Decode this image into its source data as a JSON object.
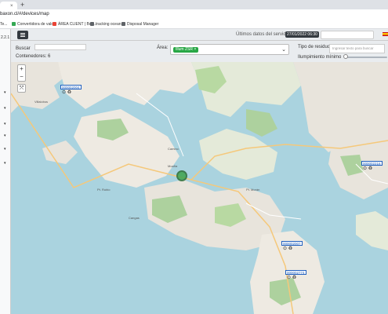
{
  "browser": {
    "tab_close": "×",
    "new_tab": "+",
    "url": "baxon.cl/#/devices/map",
    "bookmarks": [
      {
        "label": "Te...",
        "color": "#4285f4"
      },
      {
        "label": "Convertidora de valo...",
        "color": "#34a853"
      },
      {
        "label": "ÁREA CLIENT | Bon...",
        "color": "#ea4335"
      },
      {
        "label": "tracking ocean",
        "color": "#5f6368"
      },
      {
        "label": "Disposal Manager",
        "color": "#5f6368"
      }
    ]
  },
  "app": {
    "version": "2.2.1",
    "server_label": "Últimos datos del servidor:",
    "server_date": "27/01/2022 06:30",
    "side_arrow": "▾"
  },
  "filters": {
    "search_label": "Buscar",
    "search_value": "",
    "containers_label": "Contenedores: 6",
    "area_label": "Área:",
    "area_tag": "Illum ZSR ×",
    "area_chevron": "⌄",
    "residuo_label": "Tipo de residuo:",
    "residuo_placeholder": "Ingresar texto para buscar",
    "llenado_label": "Ilumpimiento mínimo",
    "llenado_value": 0
  },
  "map": {
    "zoom_in": "+",
    "zoom_out": "−",
    "fullscreen": "⤧",
    "markers": [
      {
        "id": "000002004",
        "icons": "⊙ ♻"
      },
      {
        "id": "000002216",
        "icons": "⊙ ♻"
      },
      {
        "id": "000002007",
        "icons": "⊙ ♻"
      },
      {
        "id": "000002774",
        "icons": "⊙ ♻"
      }
    ],
    "places": [
      "Villalobos",
      "Camino",
      "Moaña",
      "Pt. Morán",
      "Cangas",
      "Pt. Rubio"
    ]
  }
}
